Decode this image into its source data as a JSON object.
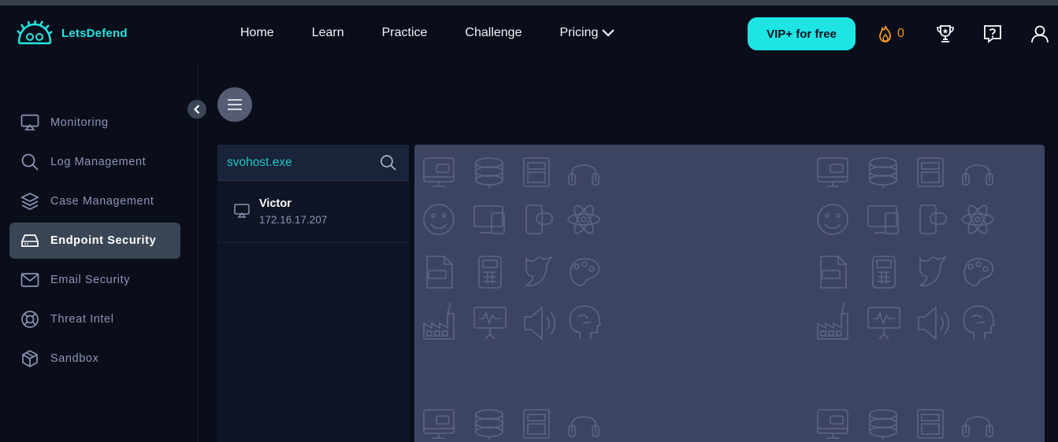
{
  "header": {
    "logo_text": "LetsDefend",
    "nav": [
      "Home",
      "Learn",
      "Practice",
      "Challenge",
      "Pricing"
    ],
    "vip_label": "VIP+ for free",
    "streak_count": "0",
    "colors": {
      "accent": "#1ee5e3",
      "streak": "#f39a2d",
      "background": "#0a0d1a"
    }
  },
  "sidebar": {
    "items": [
      {
        "label": "Monitoring",
        "icon": "monitor-icon",
        "active": false
      },
      {
        "label": "Log Management",
        "icon": "search-icon",
        "active": false
      },
      {
        "label": "Case Management",
        "icon": "layers-icon",
        "active": false
      },
      {
        "label": "Endpoint Security",
        "icon": "hard-drive-icon",
        "active": true
      },
      {
        "label": "Email Security",
        "icon": "mail-icon",
        "active": false
      },
      {
        "label": "Threat Intel",
        "icon": "lifebuoy-icon",
        "active": false
      },
      {
        "label": "Sandbox",
        "icon": "box-icon",
        "active": false
      }
    ]
  },
  "search": {
    "value": "svohost.exe"
  },
  "endpoints": [
    {
      "name": "Victor",
      "ip": "172.16.17.207"
    }
  ]
}
